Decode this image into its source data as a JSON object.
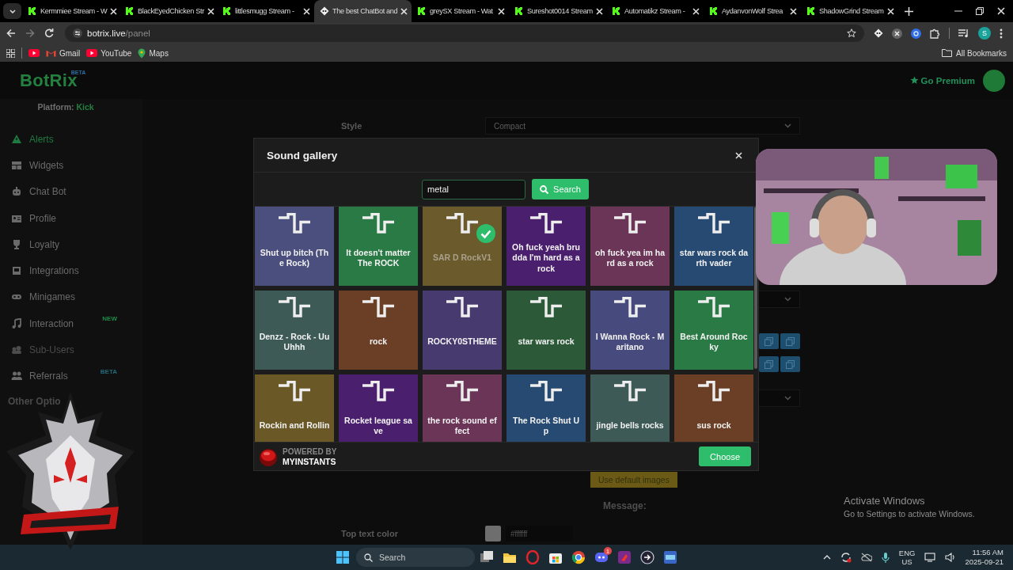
{
  "browser": {
    "tabs": [
      {
        "title": "Kermmiee Stream - W",
        "kind": "kick",
        "selected": false
      },
      {
        "title": "BlackEyedChicken Str",
        "kind": "kick",
        "selected": false
      },
      {
        "title": "littlesmugg Stream -",
        "kind": "kick",
        "selected": false
      },
      {
        "title": "The best ChatBot and",
        "kind": "botrix",
        "selected": true
      },
      {
        "title": "greySX Stream - Wat",
        "kind": "kick",
        "selected": false
      },
      {
        "title": "Sureshot0014 Stream",
        "kind": "kick",
        "selected": false
      },
      {
        "title": "Automatikz Stream -",
        "kind": "kick",
        "selected": false
      },
      {
        "title": "AydanvonWolf Strea",
        "kind": "kick",
        "selected": false
      },
      {
        "title": "ShadowGrind Stream",
        "kind": "kick",
        "selected": false
      }
    ],
    "address": {
      "host": "botrix.live",
      "path": "/panel"
    },
    "profile_initial": "S",
    "bookmarks": [
      {
        "label": "Gmail"
      },
      {
        "label": "YouTube"
      },
      {
        "label": "Maps"
      }
    ],
    "all_bookmarks": "All Bookmarks"
  },
  "header": {
    "logo": "BotRix",
    "logo_badge": "BETA",
    "premium": "Go Premium"
  },
  "sidebar": {
    "platform_label": "Platform:",
    "platform": "Kick",
    "items": [
      {
        "label": "Alerts",
        "selected": true,
        "disabled": false
      },
      {
        "label": "Widgets",
        "selected": false,
        "disabled": false
      },
      {
        "label": "Chat Bot",
        "selected": false,
        "disabled": false
      },
      {
        "label": "Profile",
        "selected": false,
        "disabled": false
      },
      {
        "label": "Loyalty",
        "selected": false,
        "disabled": false
      },
      {
        "label": "Integrations",
        "selected": false,
        "disabled": false
      },
      {
        "label": "Minigames",
        "selected": false,
        "disabled": false
      },
      {
        "label": "Interaction",
        "selected": false,
        "disabled": false,
        "badge": "NEW"
      },
      {
        "label": "Sub-Users",
        "selected": false,
        "disabled": true
      },
      {
        "label": "Referrals",
        "selected": false,
        "disabled": false,
        "badge": "BETA"
      }
    ],
    "section_title": "Other Optio"
  },
  "panel": {
    "style_label": "Style",
    "style_value": "Compact",
    "default_images": "Use default images",
    "message_label": "Message:",
    "top_text_color_label": "Top text color",
    "top_text_color_value": "#ffffff"
  },
  "sound_gallery": {
    "title": "Sound gallery",
    "search": {
      "value": "metal"
    },
    "search_button": "Search",
    "sounds": [
      {
        "name": "Shut up bitch (The Rock)",
        "color": "#4b4f7e",
        "selected": false
      },
      {
        "name": "It doesn't matter The ROCK",
        "color": "#2a7a46",
        "selected": false
      },
      {
        "name": "SAR D RockV1",
        "color": "#6a5a2c",
        "selected": true
      },
      {
        "name": "Oh fuck yeah brudda I'm hard as a rock",
        "color": "#4a1f6e",
        "selected": false
      },
      {
        "name": "oh fuck yea im hard as a rock",
        "color": "#6b3557",
        "selected": false
      },
      {
        "name": "star wars rock darth vader",
        "color": "#274a72",
        "selected": false
      },
      {
        "name": "Denzz - Rock - Uu Uhhh",
        "color": "#3d5a57",
        "selected": false
      },
      {
        "name": "rock",
        "color": "#6b3f26",
        "selected": false
      },
      {
        "name": "ROCKY0STHEME",
        "color": "#473a6f",
        "selected": false
      },
      {
        "name": "star wars rock",
        "color": "#2c5a39",
        "selected": false
      },
      {
        "name": "I Wanna Rock - Maritano",
        "color": "#474a7c",
        "selected": false
      },
      {
        "name": "Best Around Rocky",
        "color": "#2a7a46",
        "selected": false
      },
      {
        "name": "Rockin and Rollin",
        "color": "#6a5827",
        "selected": false
      },
      {
        "name": "Rocket league save",
        "color": "#4a1f6e",
        "selected": false
      },
      {
        "name": "the rock sound effect",
        "color": "#6b3557",
        "selected": false
      },
      {
        "name": "The Rock Shut Up",
        "color": "#274a72",
        "selected": false
      },
      {
        "name": "jingle bells rocks",
        "color": "#3d5a57",
        "selected": false
      },
      {
        "name": "sus rock",
        "color": "#6b3f26",
        "selected": false
      }
    ],
    "powered_by": "POWERED BY",
    "provider": "MYINSTANTS",
    "choose": "Choose"
  },
  "activation_notice": {
    "title": "Activate Windows",
    "text": "Go to Settings to activate Windows."
  },
  "taskbar": {
    "search": "Search",
    "notification_badge": "1",
    "language": "ENG",
    "region": "US",
    "time": "11:56 AM",
    "date": "2025-09-21"
  }
}
